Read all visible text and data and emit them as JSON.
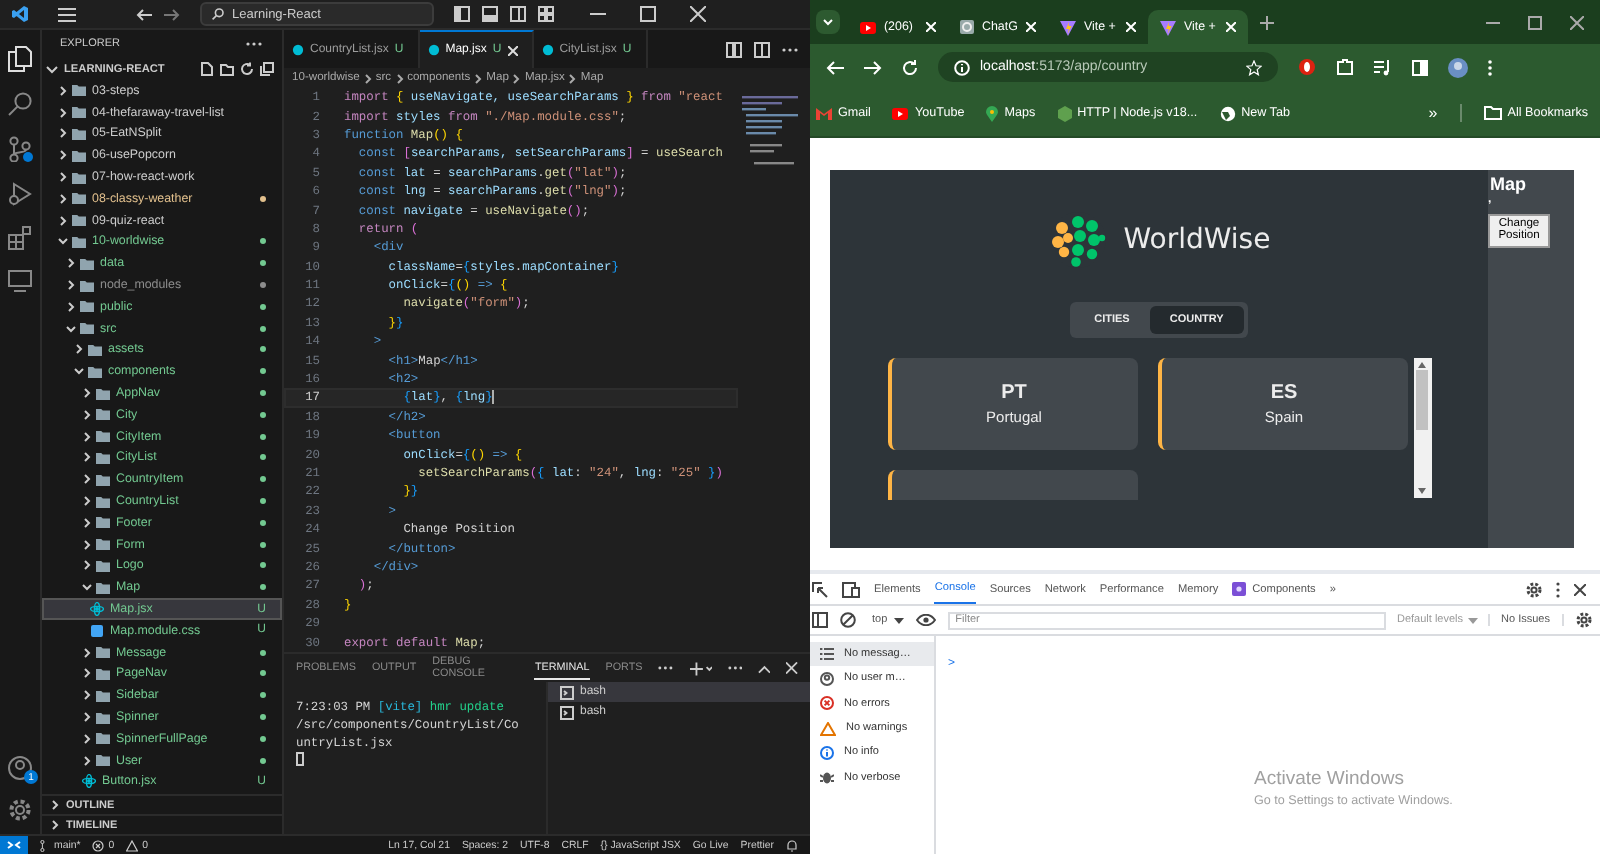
{
  "vscode": {
    "title_search": "Learning-React",
    "explorer_title": "EXPLORER",
    "workspace": "LEARNING-REACT",
    "account_badge": "1",
    "tree": [
      {
        "name": "03-steps",
        "kind": "folder",
        "expanded": false,
        "selected": false,
        "color": "#cccccc"
      },
      {
        "name": "04-thefaraway-travel-list",
        "kind": "folder",
        "expanded": false,
        "selected": false,
        "color": "#cccccc"
      },
      {
        "name": "05-EatNSplit",
        "kind": "folder",
        "expanded": false,
        "selected": false,
        "color": "#cccccc"
      },
      {
        "name": "06-usePopcorn",
        "kind": "folder",
        "expanded": false,
        "selected": false,
        "color": "#cccccc"
      },
      {
        "name": "07-how-react-work",
        "kind": "folder",
        "expanded": false,
        "selected": false,
        "color": "#cccccc"
      },
      {
        "name": "08-classy-weather",
        "kind": "folder",
        "expanded": false,
        "selected": false,
        "color": "#e2c08d",
        "dot": true
      },
      {
        "name": "09-quiz-react",
        "kind": "folder",
        "expanded": false,
        "selected": false,
        "color": "#cccccc"
      },
      {
        "name": "10-worldwise",
        "kind": "folder",
        "expanded": true,
        "selected": false,
        "color": "#73c991",
        "dot": true,
        "children": [
          {
            "name": "data",
            "kind": "folder",
            "expanded": false,
            "selected": false,
            "color": "#73c991",
            "dot": true
          },
          {
            "name": "node_modules",
            "kind": "folder",
            "expanded": false,
            "selected": false,
            "color": "#8c8c8c",
            "dot": true
          },
          {
            "name": "public",
            "kind": "folder",
            "expanded": false,
            "selected": false,
            "color": "#73c991",
            "dot": true
          },
          {
            "name": "src",
            "kind": "folder",
            "expanded": true,
            "selected": false,
            "color": "#73c991",
            "dot": true,
            "children": [
              {
                "name": "assets",
                "kind": "folder",
                "expanded": false,
                "selected": false,
                "color": "#73c991",
                "dot": true
              },
              {
                "name": "components",
                "kind": "folder",
                "expanded": true,
                "selected": false,
                "color": "#73c991",
                "dot": true,
                "children": [
                  {
                    "name": "AppNav",
                    "kind": "folder",
                    "expanded": false,
                    "selected": false,
                    "color": "#73c991",
                    "dot": true
                  },
                  {
                    "name": "City",
                    "kind": "folder",
                    "expanded": false,
                    "selected": false,
                    "color": "#73c991",
                    "dot": true
                  },
                  {
                    "name": "CityItem",
                    "kind": "folder",
                    "expanded": false,
                    "selected": false,
                    "color": "#73c991",
                    "dot": true
                  },
                  {
                    "name": "CityList",
                    "kind": "folder",
                    "expanded": false,
                    "selected": false,
                    "color": "#73c991",
                    "dot": true
                  },
                  {
                    "name": "CountryItem",
                    "kind": "folder",
                    "expanded": false,
                    "selected": false,
                    "color": "#73c991",
                    "dot": true
                  },
                  {
                    "name": "CountryList",
                    "kind": "folder",
                    "expanded": false,
                    "selected": false,
                    "color": "#73c991",
                    "dot": true
                  },
                  {
                    "name": "Footer",
                    "kind": "folder",
                    "expanded": false,
                    "selected": false,
                    "color": "#73c991",
                    "dot": true
                  },
                  {
                    "name": "Form",
                    "kind": "folder",
                    "expanded": false,
                    "selected": false,
                    "color": "#73c991",
                    "dot": true
                  },
                  {
                    "name": "Logo",
                    "kind": "folder",
                    "expanded": false,
                    "selected": false,
                    "color": "#73c991",
                    "dot": true
                  },
                  {
                    "name": "Map",
                    "kind": "folder",
                    "expanded": true,
                    "selected": false,
                    "color": "#73c991",
                    "dot": true,
                    "children": [
                      {
                        "name": "Map.jsx",
                        "kind": "jsx",
                        "selected": true,
                        "color": "#73c991",
                        "badge": "U"
                      },
                      {
                        "name": "Map.module.css",
                        "kind": "css",
                        "selected": false,
                        "color": "#73c991",
                        "badge": "U"
                      }
                    ]
                  },
                  {
                    "name": "Message",
                    "kind": "folder",
                    "expanded": false,
                    "selected": false,
                    "color": "#73c991",
                    "dot": true
                  },
                  {
                    "name": "PageNav",
                    "kind": "folder",
                    "expanded": false,
                    "selected": false,
                    "color": "#73c991",
                    "dot": true
                  },
                  {
                    "name": "Sidebar",
                    "kind": "folder",
                    "expanded": false,
                    "selected": false,
                    "color": "#73c991",
                    "dot": true
                  },
                  {
                    "name": "Spinner",
                    "kind": "folder",
                    "expanded": false,
                    "selected": false,
                    "color": "#73c991",
                    "dot": true
                  },
                  {
                    "name": "SpinnerFullPage",
                    "kind": "folder",
                    "expanded": false,
                    "selected": false,
                    "color": "#73c991",
                    "dot": true
                  },
                  {
                    "name": "User",
                    "kind": "folder",
                    "expanded": false,
                    "selected": false,
                    "color": "#73c991",
                    "dot": true
                  },
                  {
                    "name": "Button.jsx",
                    "kind": "jsx",
                    "selected": false,
                    "color": "#73c991",
                    "badge": "U"
                  }
                ]
              }
            ]
          }
        ]
      }
    ],
    "outline": "OUTLINE",
    "timeline": "TIMELINE",
    "tabs": [
      {
        "label": "CountryList.jsx",
        "status": "U",
        "selected": false
      },
      {
        "label": "Map.jsx",
        "status": "U",
        "selected": true
      },
      {
        "label": "CityList.jsx",
        "status": "U",
        "selected": false
      }
    ],
    "breadcrumb": [
      "10-worldwise",
      "src",
      "components",
      "Map",
      "Map.jsx",
      "Map"
    ],
    "code": [
      {
        "number": "1",
        "current": false,
        "tokens": [
          {
            "kind": "keyword",
            "text": "import"
          },
          {
            "kind": "brace1",
            "text": " {"
          },
          {
            "kind": "variable",
            "text": " useNavigate, useSearchParams "
          },
          {
            "kind": "brace1",
            "text": "}"
          },
          {
            "kind": "keyword",
            "text": " from"
          },
          {
            "kind": "string",
            "text": " \"react"
          }
        ]
      },
      {
        "number": "2",
        "current": false,
        "tokens": [
          {
            "kind": "keyword",
            "text": "import"
          },
          {
            "kind": "variable",
            "text": " styles"
          },
          {
            "kind": "keyword",
            "text": " from"
          },
          {
            "kind": "string",
            "text": " \"./Map.module.css\""
          },
          {
            "kind": "plain",
            "text": ";"
          }
        ]
      },
      {
        "number": "3",
        "current": false,
        "tokens": [
          {
            "kind": "storage",
            "text": "function"
          },
          {
            "kind": "function",
            "text": " Map"
          },
          {
            "kind": "brace1",
            "text": "()"
          },
          {
            "kind": "brace1",
            "text": " {"
          }
        ]
      },
      {
        "number": "4",
        "current": false,
        "tokens": [
          {
            "kind": "storage",
            "text": "  const"
          },
          {
            "kind": "brace2",
            "text": " ["
          },
          {
            "kind": "variable",
            "text": "searchParams, setSearchParams"
          },
          {
            "kind": "brace2",
            "text": "]"
          },
          {
            "kind": "plain",
            "text": " ="
          },
          {
            "kind": "function",
            "text": " useSearch"
          }
        ]
      },
      {
        "number": "5",
        "current": false,
        "tokens": [
          {
            "kind": "storage",
            "text": "  const"
          },
          {
            "kind": "variable",
            "text": " lat"
          },
          {
            "kind": "plain",
            "text": " ="
          },
          {
            "kind": "variable",
            "text": " searchParams"
          },
          {
            "kind": "plain",
            "text": "."
          },
          {
            "kind": "function",
            "text": "get"
          },
          {
            "kind": "brace2",
            "text": "("
          },
          {
            "kind": "string",
            "text": "\"lat\""
          },
          {
            "kind": "brace2",
            "text": ")"
          },
          {
            "kind": "plain",
            "text": ";"
          }
        ]
      },
      {
        "number": "6",
        "current": false,
        "tokens": [
          {
            "kind": "storage",
            "text": "  const"
          },
          {
            "kind": "variable",
            "text": " lng"
          },
          {
            "kind": "plain",
            "text": " ="
          },
          {
            "kind": "variable",
            "text": " searchParams"
          },
          {
            "kind": "plain",
            "text": "."
          },
          {
            "kind": "function",
            "text": "get"
          },
          {
            "kind": "brace2",
            "text": "("
          },
          {
            "kind": "string",
            "text": "\"lng\""
          },
          {
            "kind": "brace2",
            "text": ")"
          },
          {
            "kind": "plain",
            "text": ";"
          }
        ]
      },
      {
        "number": "7",
        "current": false,
        "tokens": [
          {
            "kind": "storage",
            "text": "  const"
          },
          {
            "kind": "variable",
            "text": " navigate"
          },
          {
            "kind": "plain",
            "text": " ="
          },
          {
            "kind": "function",
            "text": " useNavigate"
          },
          {
            "kind": "brace2",
            "text": "()"
          },
          {
            "kind": "plain",
            "text": ";"
          }
        ]
      },
      {
        "number": "8",
        "current": false,
        "tokens": [
          {
            "kind": "keyword",
            "text": "  return"
          },
          {
            "kind": "brace2",
            "text": " ("
          }
        ]
      },
      {
        "number": "9",
        "current": false,
        "tokens": [
          {
            "kind": "tag",
            "text": "    <div"
          }
        ]
      },
      {
        "number": "10",
        "current": false,
        "tokens": [
          {
            "kind": "variable",
            "text": "      className"
          },
          {
            "kind": "plain",
            "text": "="
          },
          {
            "kind": "brace3",
            "text": "{"
          },
          {
            "kind": "variable",
            "text": "styles"
          },
          {
            "kind": "plain",
            "text": "."
          },
          {
            "kind": "variable",
            "text": "mapContainer"
          },
          {
            "kind": "brace3",
            "text": "}"
          }
        ]
      },
      {
        "number": "11",
        "current": false,
        "tokens": [
          {
            "kind": "variable",
            "text": "      onClick"
          },
          {
            "kind": "plain",
            "text": "="
          },
          {
            "kind": "brace3",
            "text": "{"
          },
          {
            "kind": "brace1",
            "text": "()"
          },
          {
            "kind": "storage",
            "text": " =>"
          },
          {
            "kind": "brace1",
            "text": " {"
          }
        ]
      },
      {
        "number": "12",
        "current": false,
        "tokens": [
          {
            "kind": "function",
            "text": "        navigate"
          },
          {
            "kind": "brace2",
            "text": "("
          },
          {
            "kind": "string",
            "text": "\"form\""
          },
          {
            "kind": "brace2",
            "text": ")"
          },
          {
            "kind": "plain",
            "text": ";"
          }
        ]
      },
      {
        "number": "13",
        "current": false,
        "tokens": [
          {
            "kind": "brace1",
            "text": "      }"
          },
          {
            "kind": "brace3",
            "text": "}"
          }
        ]
      },
      {
        "number": "14",
        "current": false,
        "tokens": [
          {
            "kind": "tag",
            "text": "    >"
          }
        ]
      },
      {
        "number": "15",
        "current": false,
        "tokens": [
          {
            "kind": "tag",
            "text": "      <h1>"
          },
          {
            "kind": "plain",
            "text": "Map"
          },
          {
            "kind": "tag",
            "text": "</h1>"
          }
        ]
      },
      {
        "number": "16",
        "current": false,
        "tokens": [
          {
            "kind": "tag",
            "text": "      <h2>"
          }
        ]
      },
      {
        "number": "17",
        "current": true,
        "tokens": [
          {
            "kind": "brace3",
            "text": "        {"
          },
          {
            "kind": "variable",
            "text": "lat"
          },
          {
            "kind": "brace3",
            "text": "}"
          },
          {
            "kind": "plain",
            "text": ","
          },
          {
            "kind": "brace3",
            "text": " {"
          },
          {
            "kind": "variable",
            "text": "lng"
          },
          {
            "kind": "brace3",
            "text": "}"
          }
        ]
      },
      {
        "number": "18",
        "current": false,
        "tokens": [
          {
            "kind": "tag",
            "text": "      </h2>"
          }
        ]
      },
      {
        "number": "19",
        "current": false,
        "tokens": [
          {
            "kind": "tag",
            "text": "      <button"
          }
        ]
      },
      {
        "number": "20",
        "current": false,
        "tokens": [
          {
            "kind": "variable",
            "text": "        onClick"
          },
          {
            "kind": "plain",
            "text": "="
          },
          {
            "kind": "brace3",
            "text": "{"
          },
          {
            "kind": "brace1",
            "text": "()"
          },
          {
            "kind": "storage",
            "text": " =>"
          },
          {
            "kind": "brace1",
            "text": " {"
          }
        ]
      },
      {
        "number": "21",
        "current": false,
        "tokens": [
          {
            "kind": "function",
            "text": "          setSearchParams"
          },
          {
            "kind": "brace2",
            "text": "("
          },
          {
            "kind": "brace3",
            "text": "{"
          },
          {
            "kind": "variable",
            "text": " lat"
          },
          {
            "kind": "plain",
            "text": ":"
          },
          {
            "kind": "string",
            "text": " \"24\""
          },
          {
            "kind": "plain",
            "text": ","
          },
          {
            "kind": "variable",
            "text": " lng"
          },
          {
            "kind": "plain",
            "text": ":"
          },
          {
            "kind": "string",
            "text": " \"25\""
          },
          {
            "kind": "brace3",
            "text": " }"
          },
          {
            "kind": "brace2",
            "text": ")"
          }
        ]
      },
      {
        "number": "22",
        "current": false,
        "tokens": [
          {
            "kind": "brace1",
            "text": "        }"
          },
          {
            "kind": "brace3",
            "text": "}"
          }
        ]
      },
      {
        "number": "23",
        "current": false,
        "tokens": [
          {
            "kind": "tag",
            "text": "      >"
          }
        ]
      },
      {
        "number": "24",
        "current": false,
        "tokens": [
          {
            "kind": "plain",
            "text": "        Change Position"
          }
        ]
      },
      {
        "number": "25",
        "current": false,
        "tokens": [
          {
            "kind": "tag",
            "text": "      </button>"
          }
        ]
      },
      {
        "number": "26",
        "current": false,
        "tokens": [
          {
            "kind": "tag",
            "text": "    </div>"
          }
        ]
      },
      {
        "number": "27",
        "current": false,
        "tokens": [
          {
            "kind": "brace2",
            "text": "  )"
          },
          {
            "kind": "plain",
            "text": ";"
          }
        ]
      },
      {
        "number": "28",
        "current": false,
        "tokens": [
          {
            "kind": "brace1",
            "text": "}"
          }
        ]
      },
      {
        "number": "29",
        "current": false
      },
      {
        "number": "30",
        "current": false,
        "tokens": [
          {
            "kind": "keyword",
            "text": "export"
          },
          {
            "kind": "keyword",
            "text": " default"
          },
          {
            "kind": "function",
            "text": " Map"
          },
          {
            "kind": "plain",
            "text": ";"
          }
        ]
      }
    ],
    "panel_tabs": [
      {
        "label": "PROBLEMS",
        "selected": false
      },
      {
        "label": "OUTPUT",
        "selected": false
      },
      {
        "label": "DEBUG CONSOLE",
        "selected": false
      },
      {
        "label": "TERMINAL",
        "selected": true
      },
      {
        "label": "PORTS",
        "selected": false
      }
    ],
    "terminal_output": [
      {
        "kind": "plain",
        "text": "7:23:03 PM "
      },
      {
        "kind": "tool",
        "text": "[vite]"
      },
      {
        "kind": "ok",
        "text": " hmr update "
      },
      {
        "kind": "plain",
        "text": "/src/components/CountryList/CountryList.jsx"
      }
    ],
    "terminals": [
      {
        "label": "bash",
        "selected": true
      },
      {
        "label": "bash",
        "selected": false
      }
    ],
    "status_left": [
      {
        "kind": "branch",
        "text": "main*"
      },
      {
        "kind": "errors",
        "text": "0"
      },
      {
        "kind": "warnings",
        "text": "0"
      }
    ],
    "status_right": [
      "Ln 17, Col 21",
      "Spaces: 2",
      "UTF-8",
      "CRLF",
      "{} JavaScript JSX",
      "Go Live",
      "Prettier"
    ]
  },
  "browser": {
    "tabs": [
      {
        "label": "(206)",
        "kind": "youtube",
        "selected": false
      },
      {
        "label": "ChatG",
        "kind": "chat",
        "selected": false
      },
      {
        "label": "Vite +",
        "kind": "vite",
        "selected": false
      },
      {
        "label": "Vite +",
        "kind": "vite",
        "selected": true
      }
    ],
    "url_host": "localhost",
    "url_path": ":5173/app/country",
    "bookmarks": [
      {
        "label": "Gmail",
        "kind": "gmail"
      },
      {
        "label": "YouTube",
        "kind": "youtube"
      },
      {
        "label": "Maps",
        "kind": "maps"
      },
      {
        "label": "HTTP | Node.js v18...",
        "kind": "node"
      },
      {
        "label": "New Tab",
        "kind": "globe"
      }
    ],
    "bookmarks_more": "»",
    "all_bookmarks": "All Bookmarks"
  },
  "app": {
    "logo": "WorldWise",
    "tabs": [
      {
        "label": "CITIES",
        "selected": false
      },
      {
        "label": "COUNTRY",
        "selected": true
      }
    ],
    "countries": [
      {
        "code": "PT",
        "name": "Portugal"
      },
      {
        "code": "ES",
        "name": "Spain"
      }
    ],
    "map_title": "Map",
    "map_coords": ",",
    "map_button": "Change Position"
  },
  "devtools": {
    "tabs": [
      {
        "label": "Elements",
        "selected": false,
        "kind": "plain"
      },
      {
        "label": "Console",
        "selected": true,
        "kind": "plain"
      },
      {
        "label": "Sources",
        "selected": false,
        "kind": "plain"
      },
      {
        "label": "Network",
        "selected": false,
        "kind": "plain"
      },
      {
        "label": "Performance",
        "selected": false,
        "kind": "plain"
      },
      {
        "label": "Memory",
        "selected": false,
        "kind": "plain"
      },
      {
        "label": "Components",
        "selected": false,
        "kind": "react"
      }
    ],
    "more": "»",
    "context": "top",
    "filter_placeholder": "Filter",
    "levels": "Default levels",
    "issues": "No Issues",
    "sidebar": [
      {
        "label": "No messag…",
        "kind": "messages",
        "selected": true
      },
      {
        "label": "No user m…",
        "kind": "user",
        "selected": false
      },
      {
        "label": "No errors",
        "kind": "errors",
        "selected": false
      },
      {
        "label": "No warnings",
        "kind": "warnings",
        "selected": false
      },
      {
        "label": "No info",
        "kind": "info",
        "selected": false
      },
      {
        "label": "No verbose",
        "kind": "verbose",
        "selected": false
      }
    ],
    "prompt": ">"
  },
  "watermark_os": {
    "title": "Activate Windows",
    "subtitle": "Go to Settings to activate Windows."
  }
}
